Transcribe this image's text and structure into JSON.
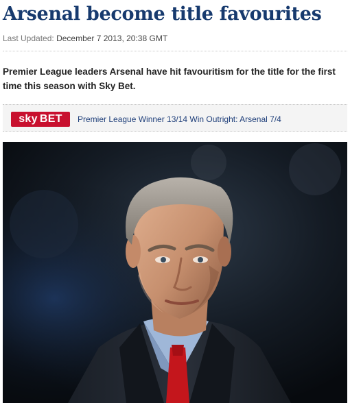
{
  "article": {
    "headline": "Arsenal become title favourites",
    "last_updated_label": "Last Updated:",
    "last_updated_value": "December 7 2013, 20:38 GMT",
    "standfirst": "Premier League leaders Arsenal have hit favouritism for the title for the first time this season with Sky Bet."
  },
  "bet_bar": {
    "logo_sky": "sky",
    "logo_bet": "BET",
    "link_text": "Premier League Winner 13/14 Win Outright: Arsenal 7/4"
  },
  "colors": {
    "headline": "#173a6e",
    "sky_bet_red": "#c8102e",
    "link": "#1f3f7a"
  }
}
